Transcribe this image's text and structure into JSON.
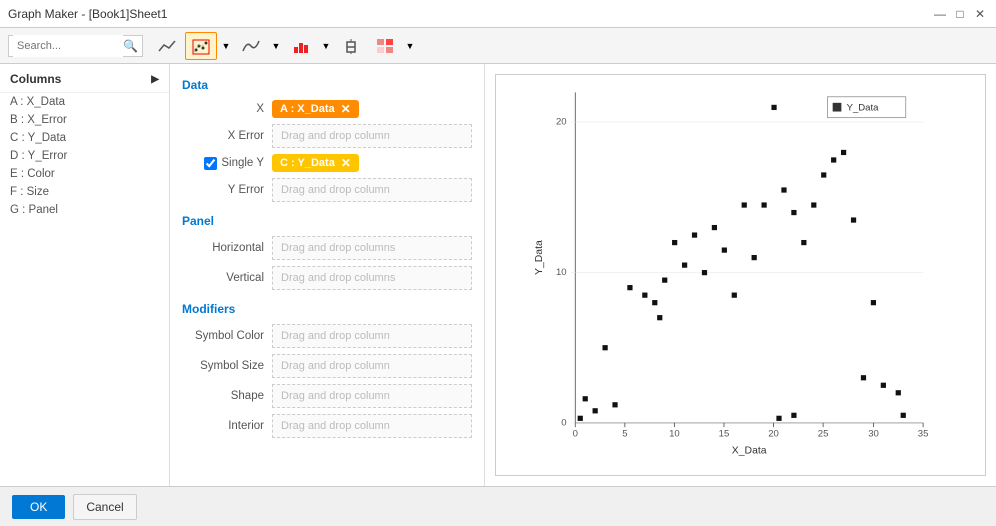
{
  "window": {
    "title": "Graph Maker - [Book1]Sheet1"
  },
  "titlebar_controls": {
    "minimize": "—",
    "maximize": "□",
    "close": "✕"
  },
  "toolbar": {
    "search_placeholder": "Search...",
    "buttons": [
      {
        "id": "scatter-line",
        "label": "∿",
        "tooltip": "Scatter with lines"
      },
      {
        "id": "scatter-dot",
        "label": "⠿",
        "tooltip": "Scatter dots",
        "active": true
      },
      {
        "id": "line",
        "label": "≋",
        "tooltip": "Line chart"
      },
      {
        "id": "bar",
        "label": "▐▌",
        "tooltip": "Bar chart"
      },
      {
        "id": "box",
        "label": "⊡",
        "tooltip": "Box plot"
      },
      {
        "id": "heatmap",
        "label": "▦",
        "tooltip": "Heatmap"
      }
    ]
  },
  "columns": {
    "header": "Columns",
    "items": [
      {
        "id": "A",
        "label": "A : X_Data"
      },
      {
        "id": "B",
        "label": "B : X_Error"
      },
      {
        "id": "C",
        "label": "C : Y_Data"
      },
      {
        "id": "D",
        "label": "D : Y_Error"
      },
      {
        "id": "E",
        "label": "E : Color"
      },
      {
        "id": "F",
        "label": "F : Size"
      },
      {
        "id": "G",
        "label": "G : Panel"
      }
    ]
  },
  "data_section": {
    "title": "Data",
    "x_label": "X",
    "x_tag": "A : X_Data",
    "x_error_label": "X Error",
    "x_error_placeholder": "Drag and drop column",
    "single_y_label": "Single  Y",
    "y_tag": "C : Y_Data",
    "y_error_label": "Y Error",
    "y_error_placeholder": "Drag and drop column"
  },
  "panel_section": {
    "title": "Panel",
    "horizontal_label": "Horizontal",
    "horizontal_placeholder": "Drag and drop columns",
    "vertical_label": "Vertical",
    "vertical_placeholder": "Drag and drop columns"
  },
  "modifiers_section": {
    "title": "Modifiers",
    "symbol_color_label": "Symbol Color",
    "symbol_color_placeholder": "Drag and drop column",
    "symbol_size_label": "Symbol Size",
    "symbol_size_placeholder": "Drag and drop column",
    "shape_label": "Shape",
    "shape_placeholder": "Drag and drop column",
    "interior_label": "Interior",
    "interior_placeholder": "Drag and drop column"
  },
  "footer": {
    "ok_label": "OK",
    "cancel_label": "Cancel"
  },
  "chart": {
    "x_axis_label": "X_Data",
    "y_axis_label": "Y_Data",
    "legend_label": "Y_Data",
    "x_ticks": [
      "0",
      "5",
      "10",
      "15",
      "20",
      "25",
      "30",
      "35"
    ],
    "y_ticks": [
      "0",
      "10",
      "20"
    ],
    "points": [
      [
        0.5,
        0.3
      ],
      [
        1.0,
        1.6
      ],
      [
        2.0,
        0.8
      ],
      [
        3.0,
        5.0
      ],
      [
        4.0,
        1.2
      ],
      [
        5.5,
        9.0
      ],
      [
        7.0,
        8.5
      ],
      [
        8.0,
        8.0
      ],
      [
        8.5,
        7.0
      ],
      [
        9.0,
        9.5
      ],
      [
        10.0,
        12.0
      ],
      [
        11.0,
        10.5
      ],
      [
        12.0,
        12.5
      ],
      [
        13.0,
        10.0
      ],
      [
        14.0,
        13.0
      ],
      [
        15.0,
        11.5
      ],
      [
        16.0,
        8.5
      ],
      [
        17.0,
        14.5
      ],
      [
        18.0,
        11.0
      ],
      [
        19.0,
        14.5
      ],
      [
        20.0,
        21.0
      ],
      [
        21.0,
        15.5
      ],
      [
        22.0,
        14.0
      ],
      [
        23.0,
        12.0
      ],
      [
        24.0,
        14.5
      ],
      [
        25.0,
        16.5
      ],
      [
        26.0,
        17.5
      ],
      [
        27.0,
        18.0
      ],
      [
        28.0,
        13.5
      ],
      [
        29.0,
        3.0
      ],
      [
        30.0,
        8.0
      ],
      [
        31.0,
        2.5
      ],
      [
        32.5,
        2.0
      ],
      [
        33.0,
        0.5
      ],
      [
        20.5,
        0.3
      ],
      [
        22.0,
        0.5
      ]
    ]
  }
}
